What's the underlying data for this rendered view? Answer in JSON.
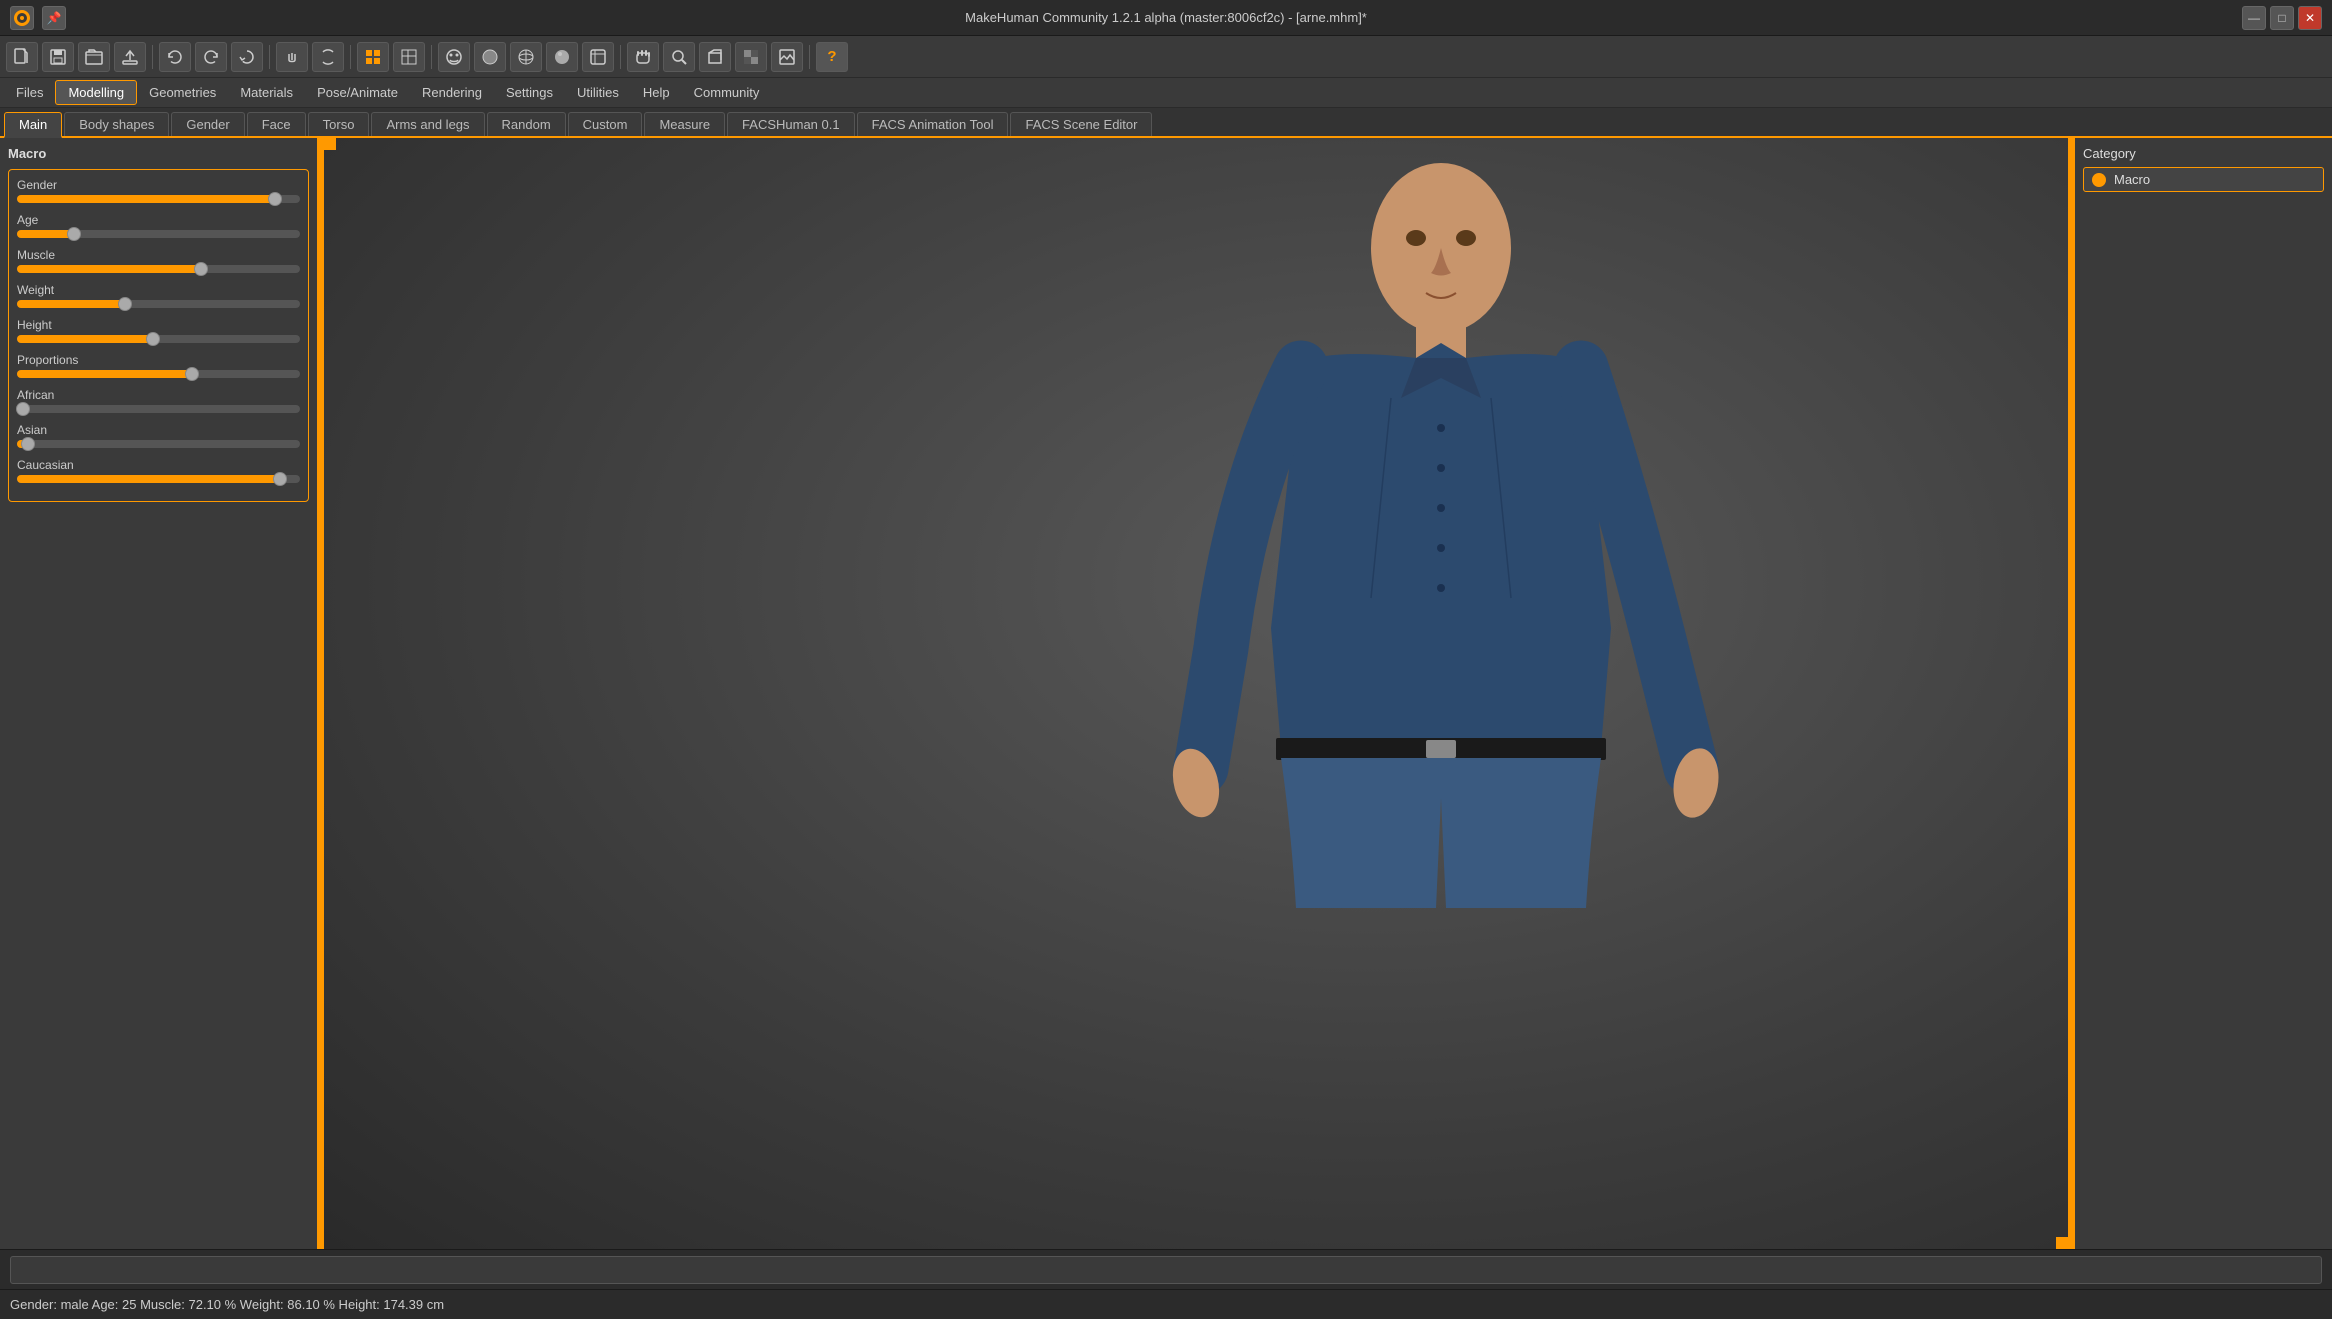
{
  "titlebar": {
    "title": "MakeHuman Community 1.2.1 alpha (master:8006cf2c) - [arne.mhm]*",
    "logo": "●",
    "pin_icon": "📌",
    "minimize": "—",
    "maximize": "□",
    "close": "✕"
  },
  "toolbar": {
    "buttons": [
      {
        "id": "new",
        "icon": "□",
        "tooltip": "New"
      },
      {
        "id": "save",
        "icon": "💾",
        "tooltip": "Save"
      },
      {
        "id": "load",
        "icon": "📂",
        "tooltip": "Load"
      },
      {
        "id": "export",
        "icon": "📤",
        "tooltip": "Export"
      },
      {
        "id": "undo",
        "icon": "↩",
        "tooltip": "Undo"
      },
      {
        "id": "redo",
        "icon": "↪",
        "tooltip": "Redo"
      },
      {
        "id": "refresh",
        "icon": "↺",
        "tooltip": "Refresh"
      },
      {
        "id": "grab",
        "icon": "✋",
        "tooltip": "Grab"
      },
      {
        "id": "rotate",
        "icon": "⟳",
        "tooltip": "Rotate"
      },
      {
        "id": "grid1",
        "icon": "▦",
        "tooltip": "Grid"
      },
      {
        "id": "grid2",
        "icon": "▩",
        "tooltip": "Grid2"
      },
      {
        "id": "face",
        "icon": "◉",
        "tooltip": "Face"
      },
      {
        "id": "smooth",
        "icon": "○",
        "tooltip": "Smooth"
      },
      {
        "id": "wire",
        "icon": "⊕",
        "tooltip": "Wireframe"
      },
      {
        "id": "solid",
        "icon": "●",
        "tooltip": "Solid"
      },
      {
        "id": "tex",
        "icon": "⊞",
        "tooltip": "Texture"
      },
      {
        "id": "hands",
        "icon": "🤝",
        "tooltip": "Hands"
      },
      {
        "id": "zoom",
        "icon": "⊙",
        "tooltip": "Zoom"
      },
      {
        "id": "box",
        "icon": "⬜",
        "tooltip": "Box"
      },
      {
        "id": "alpha",
        "icon": "▣",
        "tooltip": "Alpha"
      },
      {
        "id": "bg",
        "icon": "🖼",
        "tooltip": "Background"
      },
      {
        "id": "help",
        "icon": "?",
        "tooltip": "Help"
      }
    ]
  },
  "menubar": {
    "items": [
      {
        "id": "files",
        "label": "Files",
        "active": false
      },
      {
        "id": "modelling",
        "label": "Modelling",
        "active": true
      },
      {
        "id": "geometries",
        "label": "Geometries",
        "active": false
      },
      {
        "id": "materials",
        "label": "Materials",
        "active": false
      },
      {
        "id": "pose_animate",
        "label": "Pose/Animate",
        "active": false
      },
      {
        "id": "rendering",
        "label": "Rendering",
        "active": false
      },
      {
        "id": "settings",
        "label": "Settings",
        "active": false
      },
      {
        "id": "utilities",
        "label": "Utilities",
        "active": false
      },
      {
        "id": "help",
        "label": "Help",
        "active": false
      },
      {
        "id": "community",
        "label": "Community",
        "active": false
      }
    ]
  },
  "tabs": {
    "items": [
      {
        "id": "main",
        "label": "Main",
        "active": true
      },
      {
        "id": "body_shapes",
        "label": "Body shapes",
        "active": false
      },
      {
        "id": "gender",
        "label": "Gender",
        "active": false
      },
      {
        "id": "face",
        "label": "Face",
        "active": false
      },
      {
        "id": "torso",
        "label": "Torso",
        "active": false
      },
      {
        "id": "arms_legs",
        "label": "Arms and legs",
        "active": false
      },
      {
        "id": "random",
        "label": "Random",
        "active": false
      },
      {
        "id": "custom",
        "label": "Custom",
        "active": false
      },
      {
        "id": "measure",
        "label": "Measure",
        "active": false
      },
      {
        "id": "facs_human",
        "label": "FACSHuman 0.1",
        "active": false
      },
      {
        "id": "facs_animation",
        "label": "FACS Animation Tool",
        "active": false
      },
      {
        "id": "facs_scene",
        "label": "FACS Scene Editor",
        "active": false
      }
    ]
  },
  "left_panel": {
    "title": "Macro",
    "sliders": [
      {
        "id": "gender",
        "label": "Gender",
        "fill_pct": 91,
        "thumb_pct": 91
      },
      {
        "id": "age",
        "label": "Age",
        "fill_pct": 20,
        "thumb_pct": 20
      },
      {
        "id": "muscle",
        "label": "Muscle",
        "fill_pct": 65,
        "thumb_pct": 65
      },
      {
        "id": "weight",
        "label": "Weight",
        "fill_pct": 38,
        "thumb_pct": 38
      },
      {
        "id": "height",
        "label": "Height",
        "fill_pct": 48,
        "thumb_pct": 48
      },
      {
        "id": "proportions",
        "label": "Proportions",
        "fill_pct": 62,
        "thumb_pct": 62
      },
      {
        "id": "african",
        "label": "African",
        "fill_pct": 2,
        "thumb_pct": 2
      },
      {
        "id": "asian",
        "label": "Asian",
        "fill_pct": 4,
        "thumb_pct": 4
      },
      {
        "id": "caucasian",
        "label": "Caucasian",
        "fill_pct": 93,
        "thumb_pct": 93
      }
    ]
  },
  "right_panel": {
    "category_label": "Category",
    "selected": "Macro"
  },
  "statusbar": {
    "placeholder": ""
  },
  "infobar": {
    "text": "Gender: male  Age: 25  Muscle: 72.10 %  Weight: 86.10 %  Height: 174.39 cm"
  }
}
